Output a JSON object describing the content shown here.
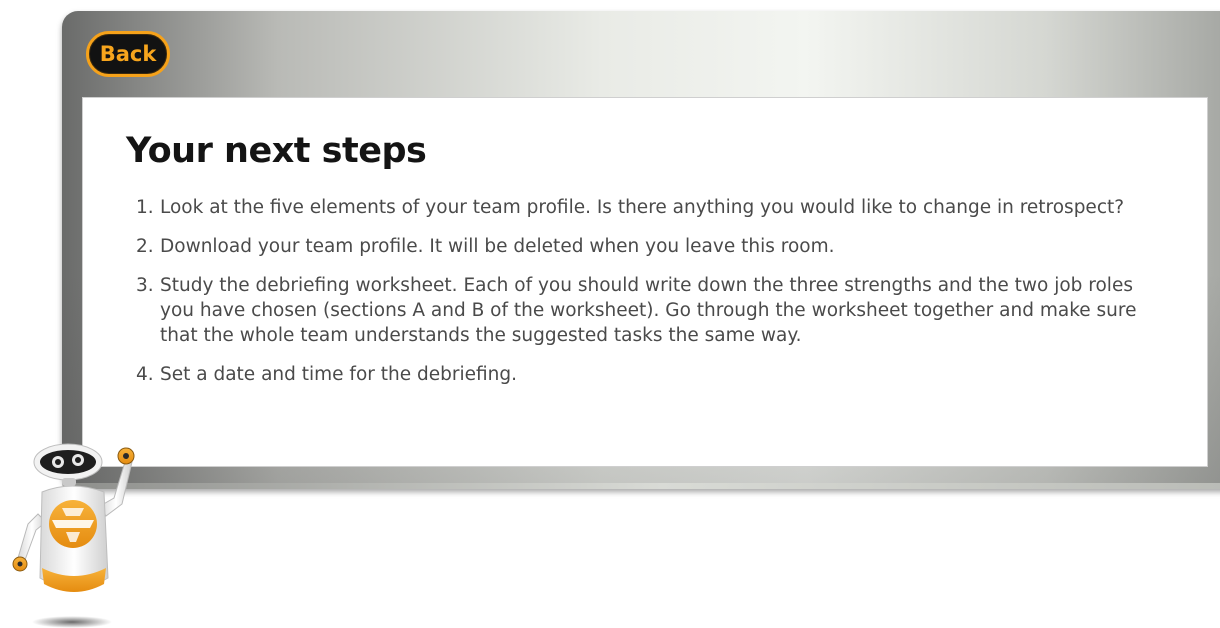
{
  "header": {
    "back_label": "Back"
  },
  "panel": {
    "title": "Your next steps",
    "steps": [
      {
        "number": "1.",
        "text": "Look at the five elements of your team profile. Is there anything you would like to change in retrospect?"
      },
      {
        "number": "2.",
        "text": "Download your team profile. It will be deleted when you leave this room."
      },
      {
        "number": "3.",
        "text": "Study the debriefing worksheet. Each of you should write down the three strengths and the two job roles you have chosen (sections A and B of the worksheet). Go through the worksheet together and make sure that the whole team understands the suggested tasks the same way."
      },
      {
        "number": "4.",
        "text": "Set a date and time for the debriefing."
      }
    ]
  },
  "colors": {
    "accent": "#f6a21a",
    "button_bg": "#121212",
    "title_text": "#141414",
    "body_text": "#4a4a4a"
  },
  "icons": {
    "mascot": "robot-mascot-icon"
  }
}
